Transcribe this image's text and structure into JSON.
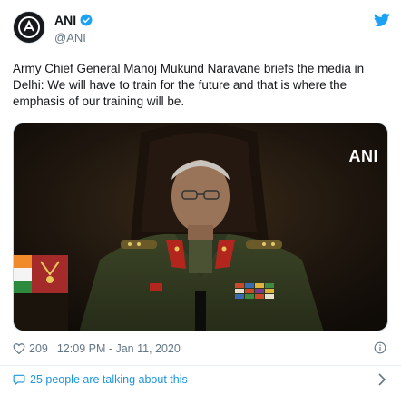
{
  "tweet": {
    "display_name": "ANI",
    "handle": "@ANI",
    "verified": true,
    "text": "Army Chief General Manoj Mukund Naravane briefs the media in Delhi: We will have to train for the future and that is where the emphasis of our training will be.",
    "media": {
      "watermark": "ANI",
      "icon": "video-still-image"
    },
    "likes": "209",
    "timestamp": "12:09 PM - Jan 11, 2020",
    "conversation_link": "25 people are talking about this"
  },
  "icons": {
    "avatar": "ani-logo-icon",
    "verified": "verified-badge-icon",
    "brand": "twitter-bird-icon",
    "like": "heart-icon",
    "info": "info-icon",
    "conversation": "speech-bubble-icon",
    "chevron": "chevron-right-icon"
  },
  "colors": {
    "link": "#1b95e0",
    "muted": "#657786",
    "text": "#14171a",
    "brand": "#1da1f2"
  }
}
